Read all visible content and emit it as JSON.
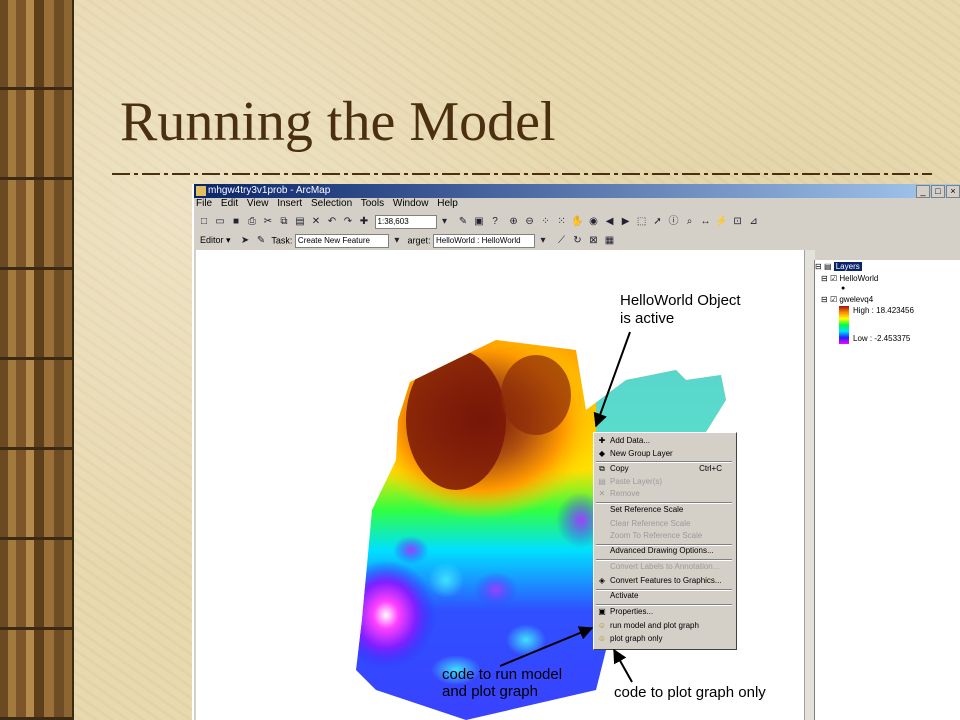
{
  "slide": {
    "title": "Running the Model"
  },
  "window": {
    "title": "mhgw4try3v1prob - ArcMap",
    "controls": [
      "_",
      "□",
      "×"
    ]
  },
  "menu": [
    "File",
    "Edit",
    "View",
    "Insert",
    "Selection",
    "Tools",
    "Window",
    "Help"
  ],
  "toolbar": {
    "scale_value": "1:38,603"
  },
  "editor_toolbar": {
    "editor_label": "Editor ▾",
    "task_label": "Task:",
    "task_value": "Create New Feature",
    "target_label": "arget:",
    "target_value": "HelloWorld : HelloWorld"
  },
  "toc": {
    "header": "Layers",
    "layers": [
      "HelloWorld",
      "gwelevq4"
    ],
    "legend_high": "High : 18.423456",
    "legend_low": "Low : -2.453375",
    "ramp_colors": [
      "#a01010",
      "#ff8800",
      "#ffff00",
      "#00ff40",
      "#00e0ff",
      "#2020ff",
      "#ff00ff"
    ]
  },
  "context_menu": {
    "items": [
      {
        "label": "Add Data...",
        "icon": "add-data-icon",
        "enabled": true
      },
      {
        "label": "New Group Layer",
        "icon": "group-layer-icon",
        "enabled": true
      },
      {
        "label": "Copy",
        "icon": "copy-icon",
        "enabled": true,
        "shortcut": "Ctrl+C"
      },
      {
        "label": "Paste Layer(s)",
        "icon": "paste-icon",
        "enabled": false
      },
      {
        "label": "Remove",
        "icon": "remove-icon",
        "enabled": false
      },
      {
        "label": "Set Reference Scale",
        "enabled": true
      },
      {
        "label": "Clear Reference Scale",
        "enabled": false
      },
      {
        "label": "Zoom To Reference Scale",
        "enabled": false
      },
      {
        "label": "Advanced Drawing Options...",
        "enabled": true
      },
      {
        "label": "Convert Labels to Annotation...",
        "enabled": false
      },
      {
        "label": "Convert Features to Graphics...",
        "icon": "convert-icon",
        "enabled": true
      },
      {
        "label": "Activate",
        "enabled": true
      },
      {
        "label": "Properties...",
        "icon": "properties-icon",
        "enabled": true
      },
      {
        "label": "run model and plot graph",
        "icon": "smiley-icon",
        "enabled": true
      },
      {
        "label": "plot graph only",
        "icon": "smiley-icon",
        "enabled": true
      }
    ]
  },
  "annotations": {
    "active_line1": "HelloWorld Object",
    "active_line2": "is active",
    "run_line1": "code to run model",
    "run_line2": "and plot graph",
    "plot_only": "code to plot graph only"
  }
}
